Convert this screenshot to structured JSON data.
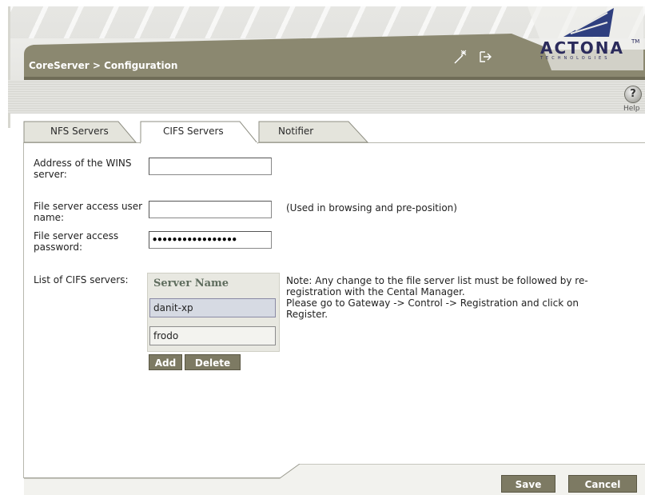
{
  "header": {
    "breadcrumb": "CoreServer > Configuration",
    "logo_word": "ACTONA",
    "logo_tm": "TM",
    "logo_sub": "TECHNOLOGIES",
    "icons": [
      "wand-icon",
      "exit-icon"
    ]
  },
  "toolbar": {
    "help_label": "Help",
    "help_icon_char": "?"
  },
  "tabs": [
    {
      "label": "NFS Servers",
      "active": false
    },
    {
      "label": "CIFS Servers",
      "active": true
    },
    {
      "label": "Notifier",
      "active": false
    }
  ],
  "form": {
    "wins_label_line1": "Address of the WINS",
    "wins_label_line2": "server:",
    "wins_value": "",
    "user_label_line1": "File server access user",
    "user_label_line2": "name:",
    "user_value": "",
    "user_note": "(Used in browsing and pre-position)",
    "password_label_line1": "File server access",
    "password_label_line2": "password:",
    "password_masked": "•••••••••••••••••",
    "list_label": "List of CIFS servers:"
  },
  "server_list": {
    "column_header": "Server Name",
    "rows": [
      {
        "name": "danit-xp",
        "selected": true
      },
      {
        "name": "frodo",
        "selected": false
      }
    ],
    "add_label": "Add",
    "delete_label": "Delete"
  },
  "note": {
    "line1": "Note: Any change to the file server list must be followed by re-",
    "line2": "registration with the Cental Manager.",
    "line3": "Please go to Gateway -> Control -> Registration and click on",
    "line4": "Register."
  },
  "footer": {
    "save_label": "Save",
    "cancel_label": "Cancel"
  },
  "colors": {
    "olive": "#7d7a63",
    "title_bar": "#8b8870",
    "accent_blue": "#2b2b5c"
  }
}
